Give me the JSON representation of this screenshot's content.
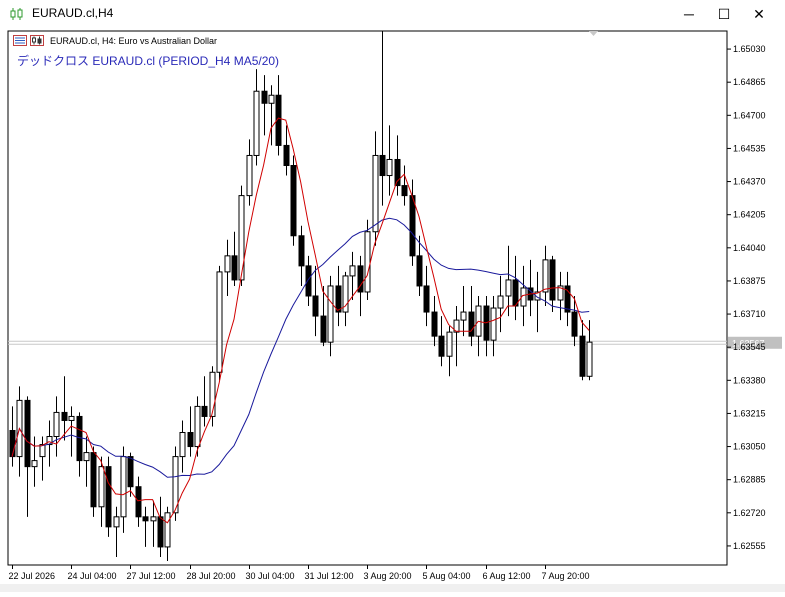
{
  "window": {
    "title": "EURAUD.cl,H4",
    "minimize_glyph": "─",
    "maximize_glyph": "☐",
    "close_glyph": "✕"
  },
  "header": {
    "symbol_info": "EURAUD.cl, H4:  Euro vs Australian Dollar",
    "indicator_label": "デッドクロス EURAUD.cl (PERIOD_H4 MA5/20)"
  },
  "icons": {
    "app": "candlestick-chart-icon",
    "chart_type": "bar-chart-icon",
    "candles": "candles-icon"
  },
  "colors": {
    "bull_body": "#ffffff",
    "bear_body": "#000000",
    "candle_line": "#000000",
    "ma_fast": "#d00000",
    "ma_slow": "#1a1a9c",
    "price_line": "#c8c8c8",
    "price_tag_bg": "#c0c0c0",
    "app_icon": "#2e9a2e"
  },
  "chart_data": {
    "type": "candlestick",
    "symbol": "EURAUD.cl",
    "timeframe": "H4",
    "y_ticks": [
      1.6503,
      1.64865,
      1.647,
      1.64535,
      1.6437,
      1.64205,
      1.6404,
      1.63875,
      1.6371,
      1.63545,
      1.6338,
      1.63215,
      1.6305,
      1.62885,
      1.6272,
      1.62555
    ],
    "ylim": [
      1.6246,
      1.6512
    ],
    "current_price": 1.63567,
    "current_price_label": "1.63567",
    "x_labels": [
      {
        "label": "22 Jul 2026",
        "index": 0
      },
      {
        "label": "24 Jul 04:00",
        "index": 8
      },
      {
        "label": "27 Jul 12:00",
        "index": 16
      },
      {
        "label": "28 Jul 20:00",
        "index": 24
      },
      {
        "label": "30 Jul 04:00",
        "index": 32
      },
      {
        "label": "31 Jul 12:00",
        "index": 40
      },
      {
        "label": "3 Aug 20:00",
        "index": 48
      },
      {
        "label": "5 Aug 04:00",
        "index": 56
      },
      {
        "label": "6 Aug 12:00",
        "index": 64
      },
      {
        "label": "7 Aug 20:00",
        "index": 72
      }
    ],
    "candles": [
      {
        "o": 1.6313,
        "h": 1.6325,
        "l": 1.6295,
        "c": 1.63
      },
      {
        "o": 1.63,
        "h": 1.6335,
        "l": 1.629,
        "c": 1.6328
      },
      {
        "o": 1.6328,
        "h": 1.633,
        "l": 1.627,
        "c": 1.6295
      },
      {
        "o": 1.6295,
        "h": 1.631,
        "l": 1.6285,
        "c": 1.6298
      },
      {
        "o": 1.63,
        "h": 1.631,
        "l": 1.6288,
        "c": 1.6306
      },
      {
        "o": 1.6306,
        "h": 1.6318,
        "l": 1.6295,
        "c": 1.631
      },
      {
        "o": 1.631,
        "h": 1.633,
        "l": 1.63,
        "c": 1.6322
      },
      {
        "o": 1.6322,
        "h": 1.634,
        "l": 1.6308,
        "c": 1.6318
      },
      {
        "o": 1.6318,
        "h": 1.6325,
        "l": 1.63,
        "c": 1.632
      },
      {
        "o": 1.632,
        "h": 1.6322,
        "l": 1.629,
        "c": 1.6298
      },
      {
        "o": 1.6298,
        "h": 1.631,
        "l": 1.6285,
        "c": 1.6302
      },
      {
        "o": 1.6302,
        "h": 1.6305,
        "l": 1.627,
        "c": 1.6275
      },
      {
        "o": 1.6275,
        "h": 1.63,
        "l": 1.6265,
        "c": 1.6295
      },
      {
        "o": 1.6295,
        "h": 1.63,
        "l": 1.626,
        "c": 1.6265
      },
      {
        "o": 1.6265,
        "h": 1.6275,
        "l": 1.625,
        "c": 1.627
      },
      {
        "o": 1.627,
        "h": 1.6305,
        "l": 1.6262,
        "c": 1.63
      },
      {
        "o": 1.63,
        "h": 1.6302,
        "l": 1.628,
        "c": 1.6285
      },
      {
        "o": 1.6285,
        "h": 1.629,
        "l": 1.6265,
        "c": 1.627
      },
      {
        "o": 1.627,
        "h": 1.6275,
        "l": 1.6255,
        "c": 1.6268
      },
      {
        "o": 1.6268,
        "h": 1.6278,
        "l": 1.6255,
        "c": 1.627
      },
      {
        "o": 1.627,
        "h": 1.628,
        "l": 1.625,
        "c": 1.6255
      },
      {
        "o": 1.6255,
        "h": 1.6275,
        "l": 1.6248,
        "c": 1.6272
      },
      {
        "o": 1.6272,
        "h": 1.6305,
        "l": 1.6268,
        "c": 1.63
      },
      {
        "o": 1.63,
        "h": 1.6318,
        "l": 1.6292,
        "c": 1.6312
      },
      {
        "o": 1.6312,
        "h": 1.6325,
        "l": 1.63,
        "c": 1.6305
      },
      {
        "o": 1.6305,
        "h": 1.633,
        "l": 1.63,
        "c": 1.6325
      },
      {
        "o": 1.6325,
        "h": 1.634,
        "l": 1.6315,
        "c": 1.632
      },
      {
        "o": 1.632,
        "h": 1.6345,
        "l": 1.6315,
        "c": 1.6342
      },
      {
        "o": 1.6342,
        "h": 1.6395,
        "l": 1.6338,
        "c": 1.6392
      },
      {
        "o": 1.6392,
        "h": 1.6408,
        "l": 1.638,
        "c": 1.64
      },
      {
        "o": 1.64,
        "h": 1.6412,
        "l": 1.6385,
        "c": 1.6388
      },
      {
        "o": 1.6388,
        "h": 1.6435,
        "l": 1.6385,
        "c": 1.643
      },
      {
        "o": 1.643,
        "h": 1.6458,
        "l": 1.6425,
        "c": 1.645
      },
      {
        "o": 1.645,
        "h": 1.6493,
        "l": 1.6445,
        "c": 1.6482
      },
      {
        "o": 1.6482,
        "h": 1.649,
        "l": 1.646,
        "c": 1.6476
      },
      {
        "o": 1.6476,
        "h": 1.6485,
        "l": 1.6455,
        "c": 1.648
      },
      {
        "o": 1.648,
        "h": 1.649,
        "l": 1.645,
        "c": 1.6455
      },
      {
        "o": 1.6455,
        "h": 1.6465,
        "l": 1.644,
        "c": 1.6445
      },
      {
        "o": 1.6445,
        "h": 1.645,
        "l": 1.6405,
        "c": 1.641
      },
      {
        "o": 1.641,
        "h": 1.6415,
        "l": 1.6385,
        "c": 1.6395
      },
      {
        "o": 1.6395,
        "h": 1.64,
        "l": 1.6375,
        "c": 1.638
      },
      {
        "o": 1.638,
        "h": 1.6395,
        "l": 1.636,
        "c": 1.637
      },
      {
        "o": 1.637,
        "h": 1.6385,
        "l": 1.6355,
        "c": 1.6357
      },
      {
        "o": 1.6357,
        "h": 1.639,
        "l": 1.635,
        "c": 1.6385
      },
      {
        "o": 1.6385,
        "h": 1.6395,
        "l": 1.6365,
        "c": 1.6372
      },
      {
        "o": 1.6372,
        "h": 1.6392,
        "l": 1.6365,
        "c": 1.639
      },
      {
        "o": 1.639,
        "h": 1.6402,
        "l": 1.6378,
        "c": 1.6395
      },
      {
        "o": 1.6395,
        "h": 1.64,
        "l": 1.637,
        "c": 1.6382
      },
      {
        "o": 1.6382,
        "h": 1.6418,
        "l": 1.6378,
        "c": 1.6412
      },
      {
        "o": 1.6412,
        "h": 1.6462,
        "l": 1.6405,
        "c": 1.645
      },
      {
        "o": 1.645,
        "h": 1.6512,
        "l": 1.6425,
        "c": 1.644
      },
      {
        "o": 1.644,
        "h": 1.6465,
        "l": 1.643,
        "c": 1.6448
      },
      {
        "o": 1.6448,
        "h": 1.646,
        "l": 1.643,
        "c": 1.6435
      },
      {
        "o": 1.6435,
        "h": 1.6445,
        "l": 1.6425,
        "c": 1.643
      },
      {
        "o": 1.643,
        "h": 1.6438,
        "l": 1.6395,
        "c": 1.64
      },
      {
        "o": 1.64,
        "h": 1.641,
        "l": 1.638,
        "c": 1.6385
      },
      {
        "o": 1.6385,
        "h": 1.6395,
        "l": 1.6365,
        "c": 1.6372
      },
      {
        "o": 1.6372,
        "h": 1.638,
        "l": 1.6355,
        "c": 1.636
      },
      {
        "o": 1.636,
        "h": 1.637,
        "l": 1.6345,
        "c": 1.635
      },
      {
        "o": 1.635,
        "h": 1.6365,
        "l": 1.634,
        "c": 1.6362
      },
      {
        "o": 1.6362,
        "h": 1.6375,
        "l": 1.6345,
        "c": 1.6368
      },
      {
        "o": 1.6368,
        "h": 1.6385,
        "l": 1.636,
        "c": 1.6372
      },
      {
        "o": 1.6372,
        "h": 1.6385,
        "l": 1.6355,
        "c": 1.636
      },
      {
        "o": 1.636,
        "h": 1.638,
        "l": 1.635,
        "c": 1.6375
      },
      {
        "o": 1.6375,
        "h": 1.638,
        "l": 1.635,
        "c": 1.6358
      },
      {
        "o": 1.6358,
        "h": 1.638,
        "l": 1.635,
        "c": 1.6374
      },
      {
        "o": 1.6374,
        "h": 1.639,
        "l": 1.6362,
        "c": 1.638
      },
      {
        "o": 1.638,
        "h": 1.6405,
        "l": 1.637,
        "c": 1.6388
      },
      {
        "o": 1.6388,
        "h": 1.64,
        "l": 1.6368,
        "c": 1.6375
      },
      {
        "o": 1.6375,
        "h": 1.6395,
        "l": 1.6365,
        "c": 1.6384
      },
      {
        "o": 1.6384,
        "h": 1.6398,
        "l": 1.637,
        "c": 1.6378
      },
      {
        "o": 1.6378,
        "h": 1.6392,
        "l": 1.6362,
        "c": 1.6382
      },
      {
        "o": 1.6382,
        "h": 1.6405,
        "l": 1.6375,
        "c": 1.6398
      },
      {
        "o": 1.6398,
        "h": 1.64,
        "l": 1.6372,
        "c": 1.6378
      },
      {
        "o": 1.6378,
        "h": 1.6392,
        "l": 1.6368,
        "c": 1.6385
      },
      {
        "o": 1.6385,
        "h": 1.6392,
        "l": 1.6365,
        "c": 1.6372
      },
      {
        "o": 1.6372,
        "h": 1.638,
        "l": 1.6355,
        "c": 1.636
      },
      {
        "o": 1.636,
        "h": 1.6368,
        "l": 1.6338,
        "c": 1.634
      },
      {
        "o": 1.634,
        "h": 1.6368,
        "l": 1.6338,
        "c": 1.6357
      }
    ],
    "ma_fast": {
      "period": 5
    },
    "ma_slow": {
      "period": 20
    }
  }
}
